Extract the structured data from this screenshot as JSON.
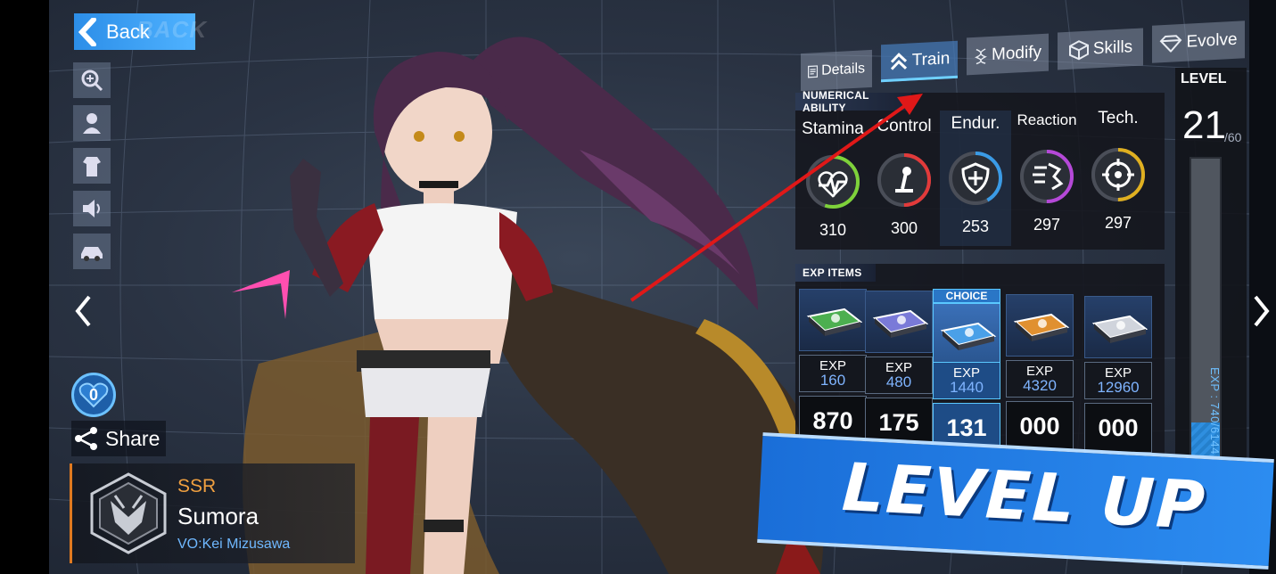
{
  "back": {
    "label": "Back",
    "watermark": "BACK"
  },
  "tabs": [
    {
      "id": "details",
      "label": "Details",
      "icon": "document-icon",
      "active": false
    },
    {
      "id": "train",
      "label": "Train",
      "icon": "double-chevron-up-icon",
      "active": true
    },
    {
      "id": "modify",
      "label": "Modify",
      "icon": "dna-icon",
      "active": false
    },
    {
      "id": "skills",
      "label": "Skills",
      "icon": "cube-icon",
      "active": false
    },
    {
      "id": "evolve",
      "label": "Evolve",
      "icon": "diamond-icon",
      "active": false
    }
  ],
  "numerical": {
    "title": "NUMERICAL ABILITY",
    "stats": [
      {
        "name": "Stamina",
        "value": "310",
        "icon": "heart-ecg-icon",
        "color": "#7ed23a",
        "fill": 0.55
      },
      {
        "name": "Control",
        "value": "300",
        "icon": "joystick-icon",
        "color": "#e23a3a",
        "fill": 0.5
      },
      {
        "name": "Endur.",
        "value": "253",
        "icon": "shield-plus-icon",
        "color": "#3a9be6",
        "fill": 0.42
      },
      {
        "name": "Reaction",
        "value": "297",
        "icon": "speed-runner-icon",
        "color": "#b548d8",
        "fill": 0.5
      },
      {
        "name": "Tech.",
        "value": "297",
        "icon": "crosshair-icon",
        "color": "#e0b020",
        "fill": 0.5
      }
    ]
  },
  "exp_items": {
    "title": "EXP ITEMS",
    "choice_label": "CHOICE",
    "items": [
      {
        "exp_label": "EXP",
        "exp": "160",
        "qty": "870",
        "color": "#4caf50",
        "choice": false
      },
      {
        "exp_label": "EXP",
        "exp": "480",
        "qty": "175",
        "color": "#7a7ad8",
        "choice": false
      },
      {
        "exp_label": "EXP",
        "exp": "1440",
        "qty": "131",
        "color": "#4aa0e8",
        "choice": true
      },
      {
        "exp_label": "EXP",
        "exp": "4320",
        "qty": "000",
        "color": "#e09030",
        "choice": false
      },
      {
        "exp_label": "EXP",
        "exp": "12960",
        "qty": "000",
        "color": "#d0d4dc",
        "choice": false
      }
    ]
  },
  "level": {
    "title": "LEVEL",
    "current": "21",
    "max": "/60",
    "exp_text": "EXP : 740/6144",
    "progress": 0.12
  },
  "share": {
    "label": "Share"
  },
  "likes": {
    "count": "0"
  },
  "character": {
    "rarity": "SSR",
    "name": "Sumora",
    "vo": "VO:Kei Mizusawa"
  },
  "banner": {
    "text": "LEVEL UP"
  },
  "colors": {
    "accent": "#2c8ee8",
    "rarity": "#f0a040",
    "vo": "#6fb8ff",
    "annotation": "#e01818"
  }
}
